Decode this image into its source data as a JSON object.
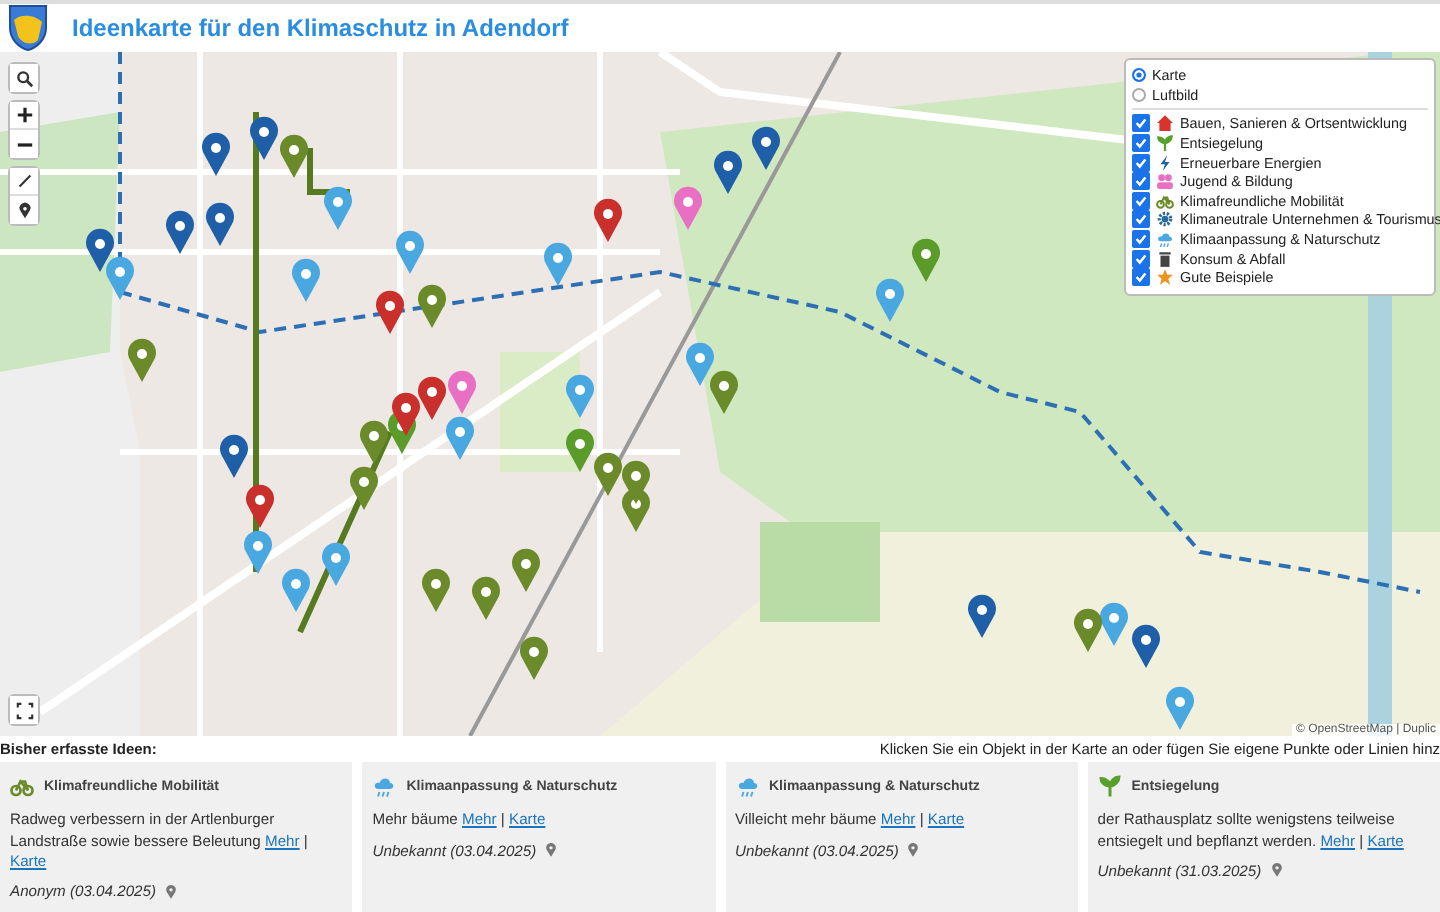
{
  "header": {
    "title": "Ideenkarte für den Klimaschutz in Adendorf"
  },
  "layers": {
    "base": [
      {
        "label": "Karte",
        "selected": true
      },
      {
        "label": "Luftbild",
        "selected": false
      }
    ],
    "overlays": [
      {
        "label": "Bauen, Sanieren & Ortsentwicklung",
        "kind": "house",
        "color": "#d9342b",
        "checked": true
      },
      {
        "label": "Entsiegelung",
        "kind": "sprout",
        "color": "#5aa02c",
        "checked": true
      },
      {
        "label": "Erneuerbare Energien",
        "kind": "bolt",
        "color": "#1f5fa6",
        "checked": true
      },
      {
        "label": "Jugend & Bildung",
        "kind": "people",
        "color": "#e86fc3",
        "checked": true
      },
      {
        "label": "Klimafreundliche Mobilität",
        "kind": "bike",
        "color": "#6b8a2a",
        "checked": true
      },
      {
        "label": "Klimaneutrale Unternehmen & Tourismus",
        "kind": "gear",
        "color": "#2a6a9a",
        "checked": true
      },
      {
        "label": "Klimaanpassung & Naturschutz",
        "kind": "cloud",
        "color": "#4aa8e0",
        "checked": true
      },
      {
        "label": "Konsum & Abfall",
        "kind": "bin",
        "color": "#444444",
        "checked": true
      },
      {
        "label": "Gute Beispiele",
        "kind": "star",
        "color": "#f0931e",
        "checked": true
      }
    ]
  },
  "map": {
    "attribution": "© OpenStreetMap | Duplic"
  },
  "ideas": {
    "separator": "|",
    "heading": "Bisher erfasste Ideen:",
    "hint": "Klicken Sie ein Objekt in der Karte an oder fügen Sie eigene Punkte oder Linien hinz",
    "cards": [
      {
        "category": "Klimafreundliche Mobilität",
        "kind": "bike",
        "color": "#6b8a2a",
        "text": "Radweg verbessern in der Artlenburger Landstraße sowie bessere Beleutung",
        "more": "Mehr",
        "map_link": "Karte",
        "author": "Anonym (03.04.2025)"
      },
      {
        "category": "Klimaanpassung & Naturschutz",
        "kind": "cloud",
        "color": "#4aa8e0",
        "text": "Mehr bäume",
        "more": "Mehr",
        "map_link": "Karte",
        "author": "Unbekannt (03.04.2025)"
      },
      {
        "category": "Klimaanpassung & Naturschutz",
        "kind": "cloud",
        "color": "#4aa8e0",
        "text": "Villeicht mehr bäume",
        "more": "Mehr",
        "map_link": "Karte",
        "author": "Unbekannt (03.04.2025)"
      },
      {
        "category": "Entsiegelung",
        "kind": "sprout",
        "color": "#5aa02c",
        "text": "der Rathausplatz sollte wenigstens teilweise entsiegelt und bepflanzt werden.",
        "more": "Mehr",
        "map_link": "Karte",
        "author": "Unbekannt (31.03.2025)"
      }
    ]
  }
}
